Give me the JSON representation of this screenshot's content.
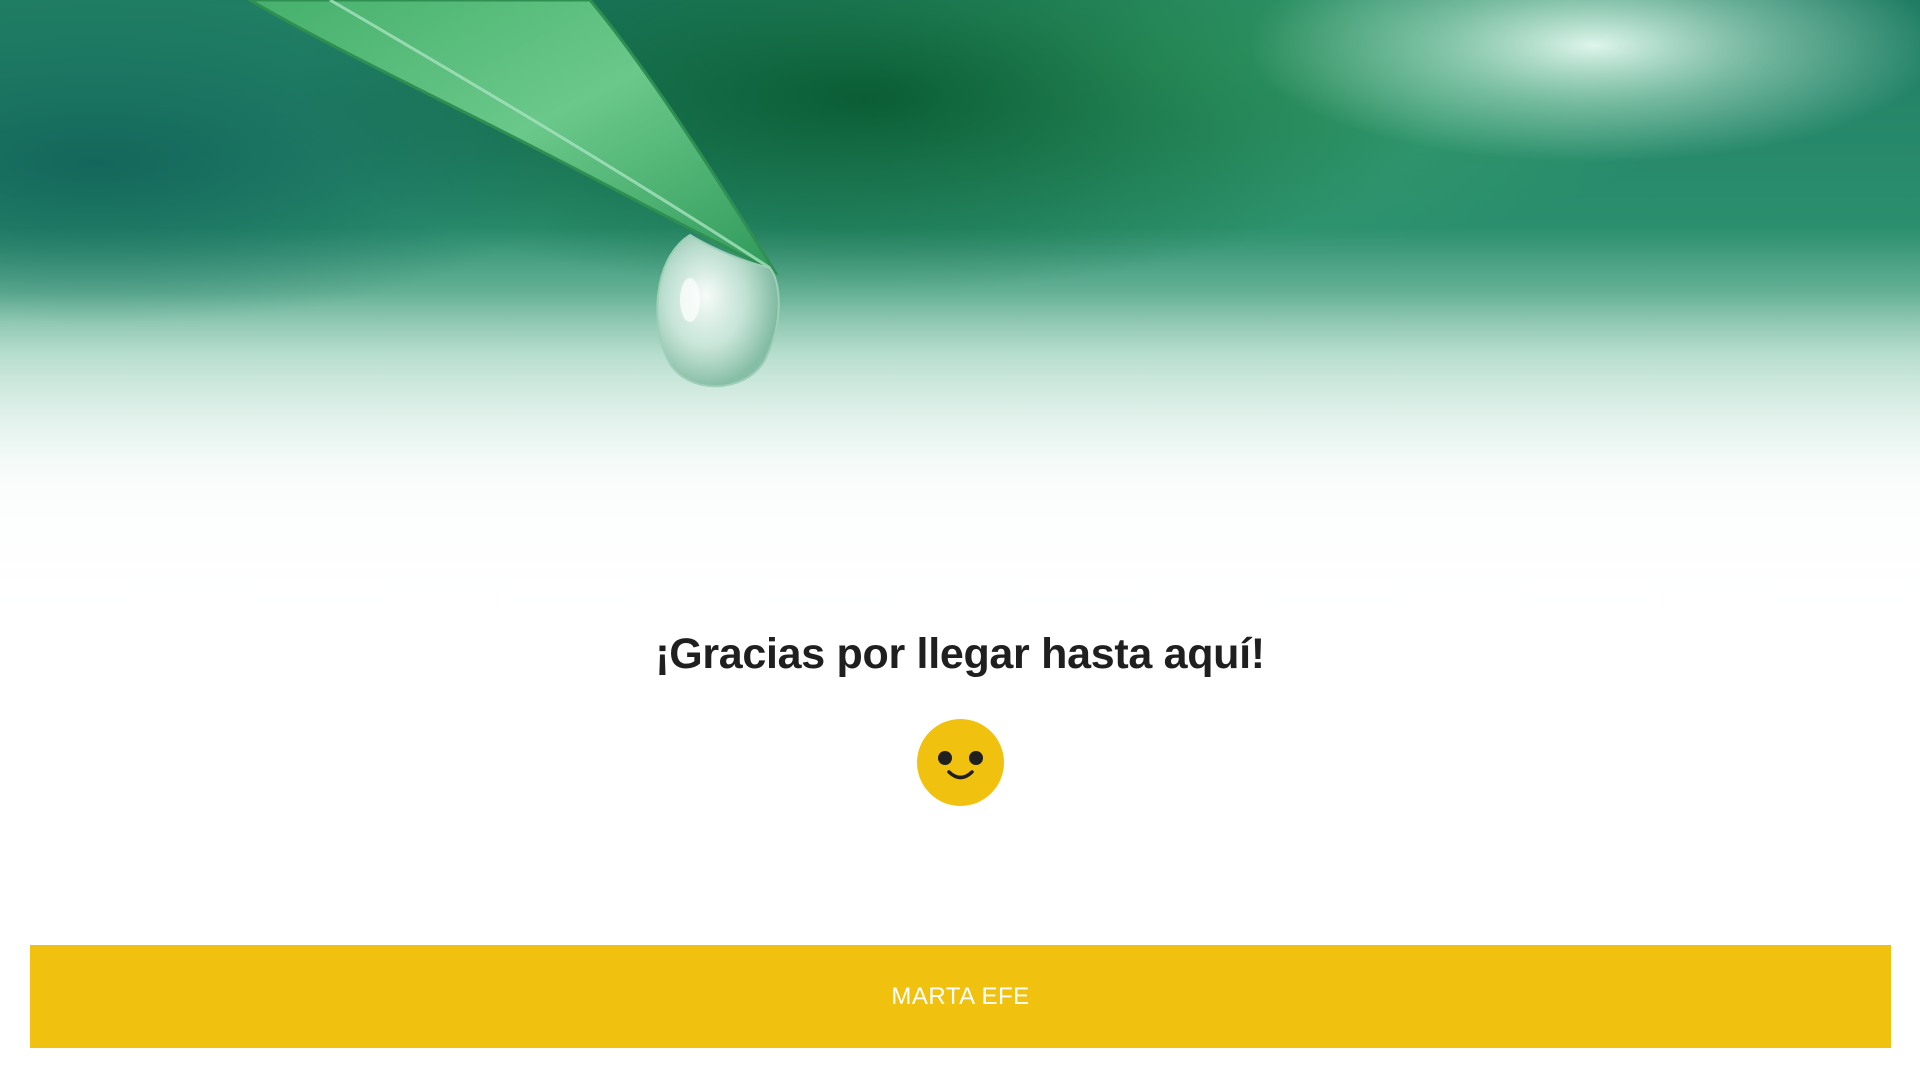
{
  "hero": {
    "image_icon": "leaf-water-drop-photo"
  },
  "content": {
    "headline": "¡Gracias por llegar hasta aquí!",
    "emoji_icon": "smiley-face-icon"
  },
  "footer": {
    "label": "MARTA EFE"
  },
  "colors": {
    "accent": "#f1c10f",
    "heading": "#1f1f1f",
    "footer_text": "#ffffff",
    "leaf_green": "#2f9a5a",
    "background": "#ffffff"
  }
}
